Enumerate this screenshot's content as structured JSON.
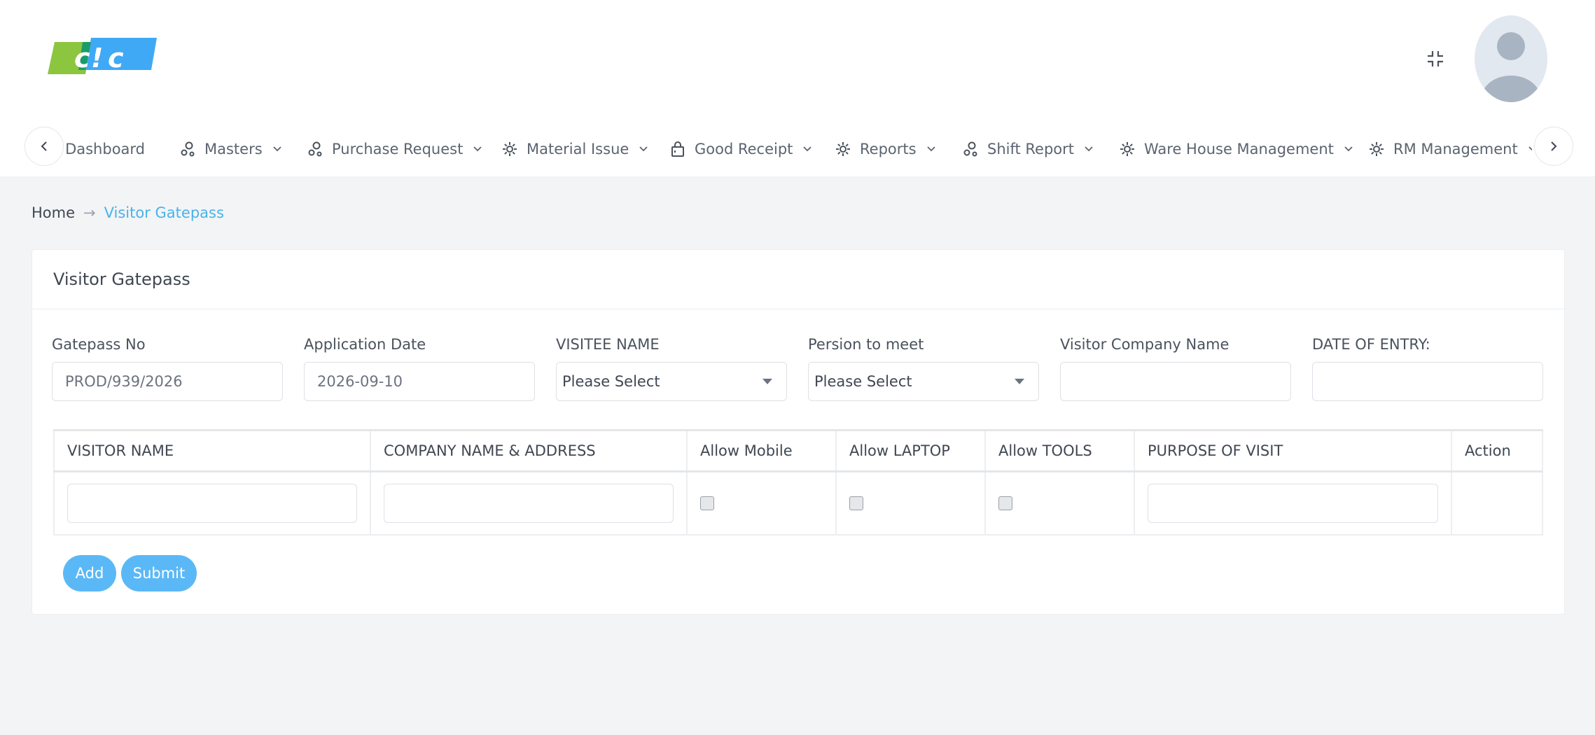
{
  "header": {
    "logo_alt": "DIC",
    "collapse_icon": "compress-icon",
    "avatar_icon": "user-avatar"
  },
  "nav": {
    "items": [
      {
        "label": "Dashboard",
        "icon": "dashboard-icon"
      },
      {
        "label": "Masters",
        "icon": "circles-icon"
      },
      {
        "label": "Purchase Request",
        "icon": "circles-icon"
      },
      {
        "label": "Material Issue",
        "icon": "gear-icon"
      },
      {
        "label": "Good Receipt",
        "icon": "lock-icon"
      },
      {
        "label": "Reports",
        "icon": "gear-icon"
      },
      {
        "label": "Shift Report",
        "icon": "circles-icon"
      },
      {
        "label": "Ware House Management",
        "icon": "gear-icon"
      },
      {
        "label": "RM Management",
        "icon": "gear-icon"
      }
    ]
  },
  "breadcrumb": {
    "home": "Home",
    "separator": "→",
    "current": "Visitor Gatepass"
  },
  "card": {
    "title": "Visitor Gatepass"
  },
  "form": {
    "gatepass_no": {
      "label": "Gatepass No",
      "value": "PROD/939/2026"
    },
    "application_date": {
      "label": "Application Date",
      "value": "2026-09-10"
    },
    "visitee_name": {
      "label": "VISITEE NAME",
      "value": "Please Select"
    },
    "person_to_meet": {
      "label": "Persion to meet",
      "value": "Please Select"
    },
    "visitor_company": {
      "label": "Visitor Company Name",
      "value": ""
    },
    "date_of_entry": {
      "label": "DATE OF ENTRY:",
      "value": ""
    }
  },
  "table": {
    "headers": [
      "VISITOR NAME",
      "COMPANY NAME & ADDRESS",
      "Allow Mobile",
      "Allow LAPTOP",
      "Allow TOOLS",
      "PURPOSE OF VISIT",
      "Action"
    ]
  },
  "buttons": {
    "add": "Add",
    "submit": "Submit"
  },
  "colors": {
    "accent": "#5bb8f6",
    "link": "#49b3e8",
    "background": "#f3f4f6"
  }
}
